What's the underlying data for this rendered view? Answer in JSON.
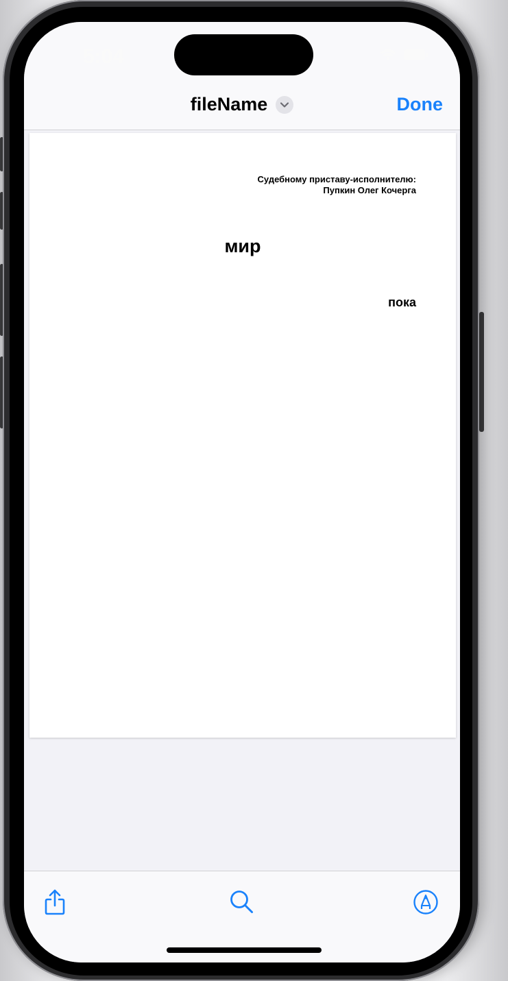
{
  "status_bar": {
    "time": "5:04"
  },
  "nav_bar": {
    "title": "fileName",
    "done_label": "Done",
    "title_menu_icon": "chevron-down-icon"
  },
  "document": {
    "addressee_line1": "Судебному приставу-исполнителю:",
    "addressee_line2": "Пупкин Олег Кочерга",
    "title": "мир",
    "closing": "пока"
  },
  "toolbar": {
    "share_icon": "share-icon",
    "search_icon": "search-icon",
    "markup_icon": "markup-icon"
  },
  "colors": {
    "accent": "#1a82fb",
    "background": "#f2f2f7",
    "bar": "#f9f9fb"
  }
}
